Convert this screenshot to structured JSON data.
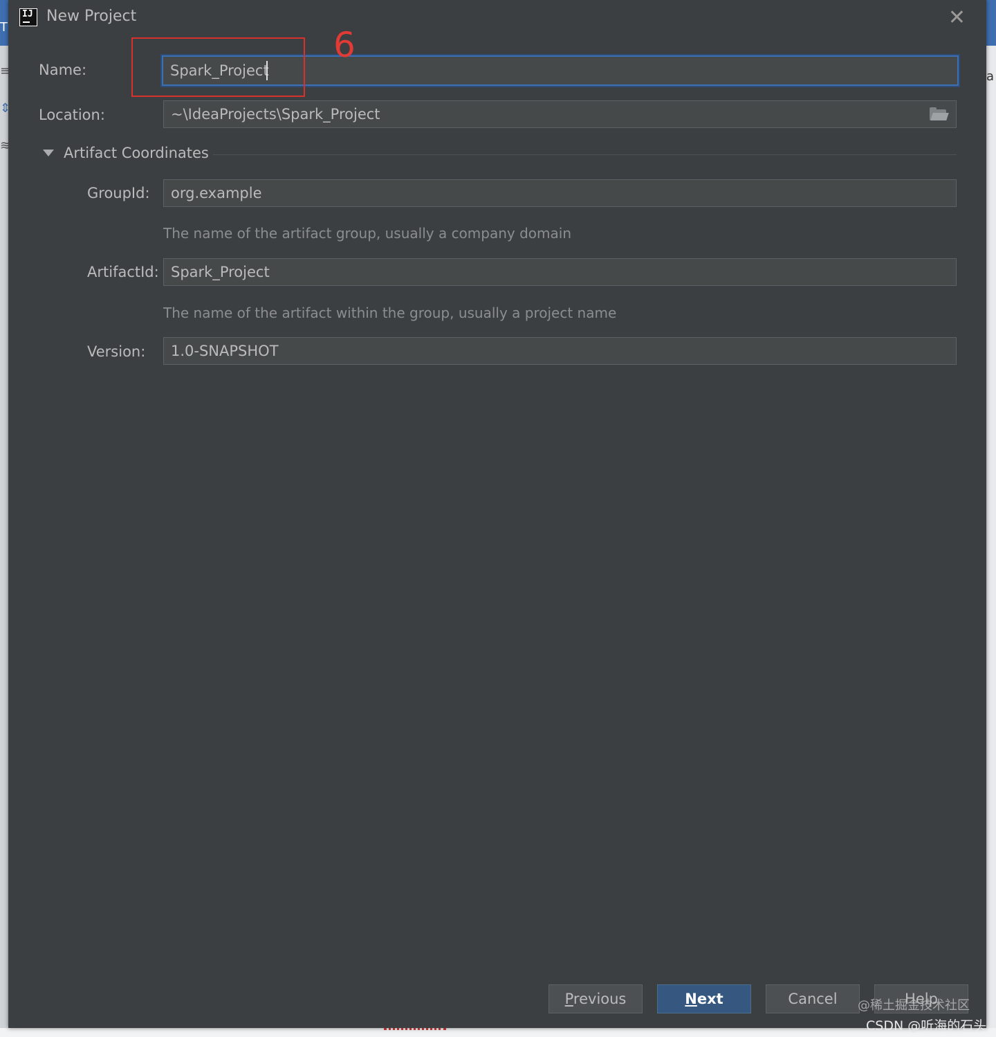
{
  "dialog": {
    "title": "New Project",
    "app_icon_text": "IJ"
  },
  "form": {
    "name_label": "Name:",
    "name_value": "Spark_Project",
    "location_label": "Location:",
    "location_value": "~\\IdeaProjects\\Spark_Project",
    "section_title": "Artifact Coordinates",
    "groupid_label": "GroupId:",
    "groupid_value": "org.example",
    "groupid_hint": "The name of the artifact group, usually a company domain",
    "artifactid_label": "ArtifactId:",
    "artifactid_value": "Spark_Project",
    "artifactid_hint": "The name of the artifact within the group, usually a project name",
    "version_label": "Version:",
    "version_value": "1.0-SNAPSHOT"
  },
  "annotation": {
    "number": "6",
    "color": "#e23a35"
  },
  "buttons": {
    "previous_mnemonic": "P",
    "previous_rest": "revious",
    "next_mnemonic": "N",
    "next_rest": "ext",
    "cancel": "Cancel",
    "help": "Help"
  },
  "watermarks": {
    "line1": "@稀土掘金技术社区",
    "line2": "CSDN @听海的石头"
  },
  "colors": {
    "dialog_bg": "#3c3f41",
    "focus_border": "#3d6fb5",
    "primary_button": "#365880"
  }
}
